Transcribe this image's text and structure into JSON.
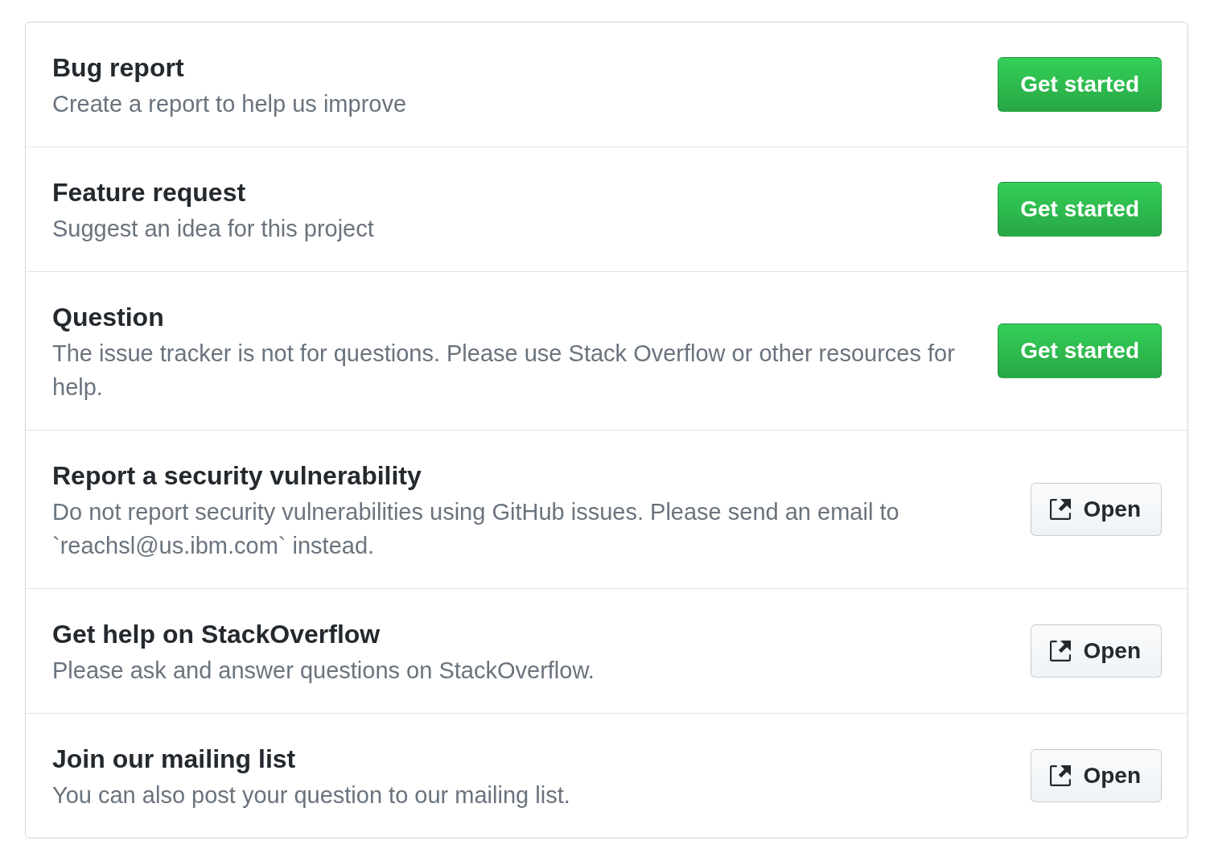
{
  "templates": [
    {
      "title": "Bug report",
      "description": "Create a report to help us improve",
      "button": {
        "kind": "primary",
        "label": "Get started"
      }
    },
    {
      "title": "Feature request",
      "description": "Suggest an idea for this project",
      "button": {
        "kind": "primary",
        "label": "Get started"
      }
    },
    {
      "title": "Question",
      "description": "The issue tracker is not for questions. Please use Stack Overflow or other resources for help.",
      "button": {
        "kind": "primary",
        "label": "Get started"
      }
    },
    {
      "title": "Report a security vulnerability",
      "description": "Do not report security vulnerabilities using GitHub issues. Please send an email to `reachsl@us.ibm.com` instead.",
      "button": {
        "kind": "external",
        "label": "Open"
      }
    },
    {
      "title": "Get help on StackOverflow",
      "description": "Please ask and answer questions on StackOverflow.",
      "button": {
        "kind": "external",
        "label": "Open"
      }
    },
    {
      "title": "Join our mailing list",
      "description": "You can also post your question to our mailing list.",
      "button": {
        "kind": "external",
        "label": "Open"
      }
    }
  ]
}
